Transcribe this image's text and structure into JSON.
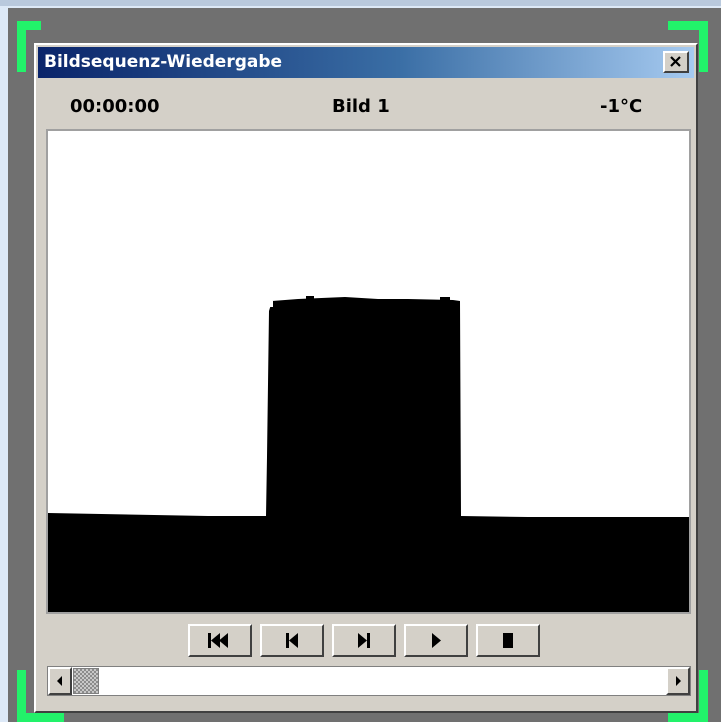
{
  "window": {
    "title": "Bildsequenz-Wiedergabe",
    "close_icon": "close-icon"
  },
  "status": {
    "time": "00:00:00",
    "frame": "Bild 1",
    "temperature": "-1°C"
  },
  "controls": {
    "buttons": [
      {
        "name": "rewind-to-start-button",
        "icon": "skip-to-start-icon"
      },
      {
        "name": "step-back-button",
        "icon": "step-back-icon"
      },
      {
        "name": "step-forward-button",
        "icon": "step-forward-icon"
      },
      {
        "name": "play-button",
        "icon": "play-icon"
      },
      {
        "name": "stop-button",
        "icon": "stop-icon"
      }
    ]
  },
  "scrollbar": {
    "position": 0
  },
  "colors": {
    "titlebar_start": "#0a246a",
    "titlebar_end": "#a6caf0",
    "corner_markers": "#22f26a",
    "outer_frame": "#707070"
  }
}
